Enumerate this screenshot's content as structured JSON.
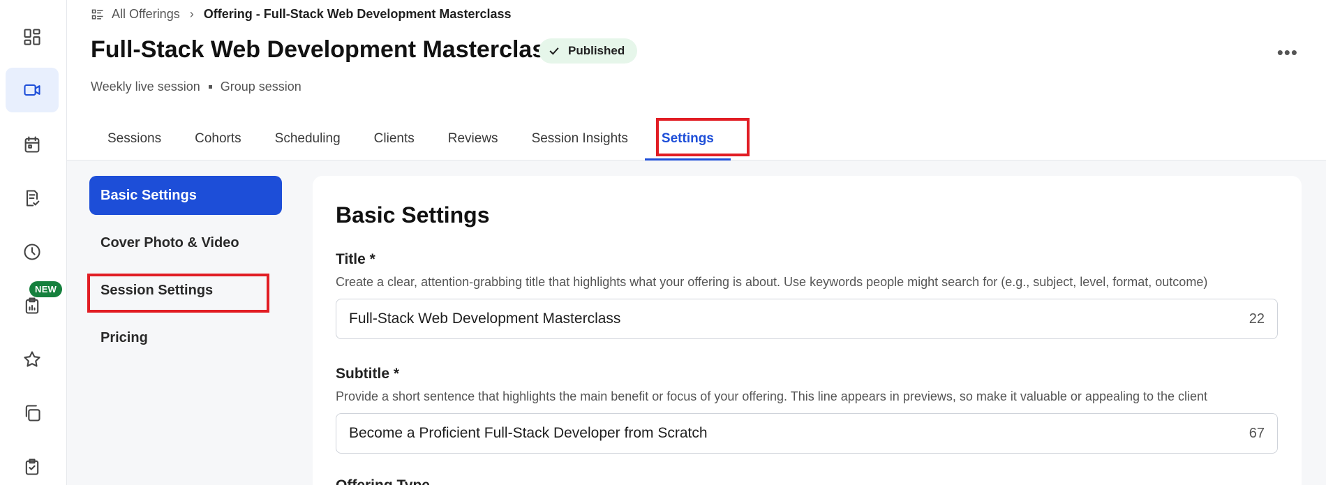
{
  "breadcrumb": {
    "root": "All Offerings",
    "current": "Offering - Full-Stack Web Development Masterclass"
  },
  "header": {
    "title": "Full-Stack Web Development Masterclass",
    "status": "Published",
    "meta": [
      "Weekly live session",
      "Group session"
    ]
  },
  "tabs": [
    {
      "label": "Sessions"
    },
    {
      "label": "Cohorts"
    },
    {
      "label": "Scheduling"
    },
    {
      "label": "Clients"
    },
    {
      "label": "Reviews"
    },
    {
      "label": "Session Insights"
    },
    {
      "label": "Settings",
      "active": true
    }
  ],
  "rail": {
    "new_badge": "NEW",
    "icons": [
      "dashboard-icon",
      "video-icon",
      "calendar-icon",
      "checklist-icon",
      "clock-icon",
      "report-icon",
      "star-icon",
      "copy-icon",
      "clipboard-check-icon"
    ]
  },
  "side_menu": [
    {
      "label": "Basic Settings",
      "active": true
    },
    {
      "label": "Cover Photo & Video"
    },
    {
      "label": "Session Settings"
    },
    {
      "label": "Pricing"
    }
  ],
  "form": {
    "heading": "Basic Settings",
    "title_field": {
      "label": "Title *",
      "help": "Create a clear, attention-grabbing title that highlights what your offering is about. Use keywords people might search for (e.g., subject, level, format, outcome)",
      "value": "Full-Stack Web Development Masterclass",
      "count": "22"
    },
    "subtitle_field": {
      "label": "Subtitle *",
      "help": "Provide a short sentence that highlights the main benefit or focus of your offering. This line appears in previews, so make it valuable or appealing to the client",
      "value": "Become a Proficient Full-Stack Developer from Scratch",
      "count": "67"
    },
    "next_label": "Offering Type"
  },
  "colors": {
    "accent": "#1d4ed8",
    "highlight": "#e11d24",
    "published_bg": "#e6f6ea",
    "new_badge": "#15803d"
  }
}
